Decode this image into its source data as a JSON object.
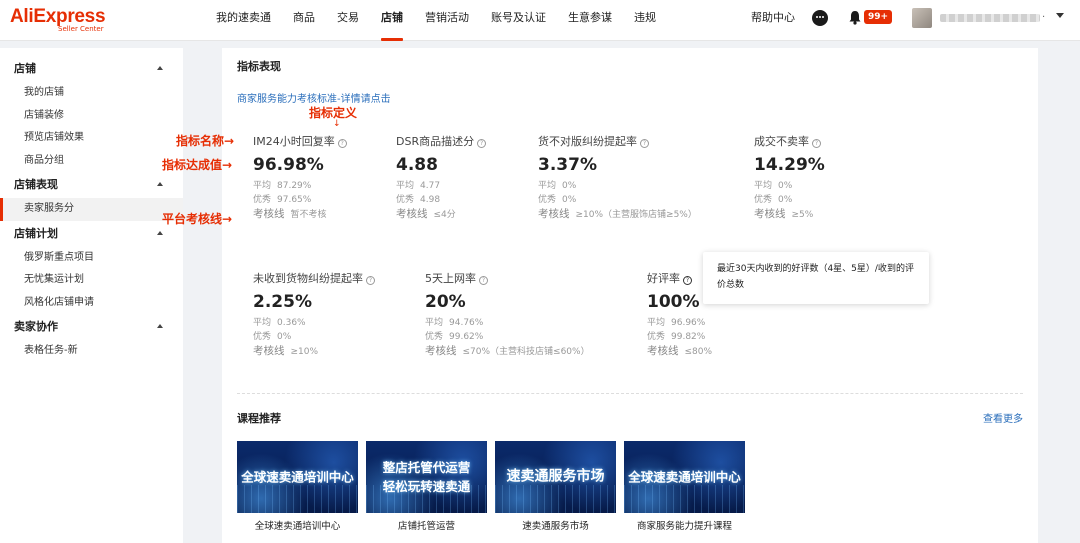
{
  "brand": {
    "name": "AliExpress",
    "sub": "Seller Center",
    "color": "#e62e04"
  },
  "nav": {
    "items": [
      "我的速卖通",
      "商品",
      "交易",
      "店铺",
      "营销活动",
      "账号及认证",
      "生意参谋",
      "违规"
    ],
    "active_index": 3,
    "help": "帮助中心",
    "badge": "99+"
  },
  "sidebar": {
    "groups": [
      {
        "title": "店铺",
        "items": [
          "我的店铺",
          "店铺装修",
          "预览店铺效果",
          "商品分组"
        ]
      },
      {
        "title": "店铺表现",
        "items": [
          "卖家服务分"
        ]
      },
      {
        "title": "店铺计划",
        "items": [
          "俄罗斯重点项目",
          "无忧集运计划",
          "风格化店铺申请"
        ]
      },
      {
        "title": "卖家协作",
        "items": [
          "表格任务-新"
        ]
      }
    ],
    "active_item": "卖家服务分"
  },
  "main": {
    "section_title": "指标表现",
    "criteria_link": "商家服务能力考核标准-详情请点击",
    "labels": {
      "avg": "平均",
      "excellent": "优秀",
      "line": "考核线"
    },
    "metrics": [
      {
        "name": "IM24小时回复率",
        "value": "96.98%",
        "avg": "87.29%",
        "excellent": "97.65%",
        "line": "暂不考核"
      },
      {
        "name": "DSR商品描述分",
        "value": "4.88",
        "avg": "4.77",
        "excellent": "4.98",
        "line": "≤4分"
      },
      {
        "name": "货不对版纠纷提起率",
        "value": "3.37%",
        "avg": "0%",
        "excellent": "0%",
        "line": "≥10%（主营服饰店铺≥5%）"
      },
      {
        "name": "成交不卖率",
        "value": "14.29%",
        "avg": "0%",
        "excellent": "0%",
        "line": "≥5%"
      },
      {
        "name": "未收到货物纠纷提起率",
        "value": "2.25%",
        "avg": "0.36%",
        "excellent": "0%",
        "line": "≥10%"
      },
      {
        "name": "5天上网率",
        "value": "20%",
        "avg": "94.76%",
        "excellent": "99.62%",
        "line": "≤70%（主营科技店铺≤60%）"
      },
      {
        "name": "好评率",
        "value": "100%",
        "avg": "96.96%",
        "excellent": "99.82%",
        "line": "≤80%"
      }
    ],
    "tooltip": "最近30天内收到的好评数（4星、5星）/收到的评价总数",
    "annotations": {
      "definition": "指标定义",
      "name": "指标名称→",
      "value": "指标达成值→",
      "line": "平台考核线→"
    },
    "courses_title": "课程推荐",
    "courses_more": "查看更多",
    "courses": [
      {
        "image_text": "全球速卖通培训中心",
        "caption": "全球速卖通培训中心"
      },
      {
        "image_text": "整店托管代运营\n轻松玩转速卖通",
        "caption": "店铺托管运营"
      },
      {
        "image_text": "速卖通服务市场",
        "caption": "速卖通服务市场"
      },
      {
        "image_text": "全球速卖通培训中心",
        "caption": "商家服务能力提升课程"
      }
    ]
  }
}
